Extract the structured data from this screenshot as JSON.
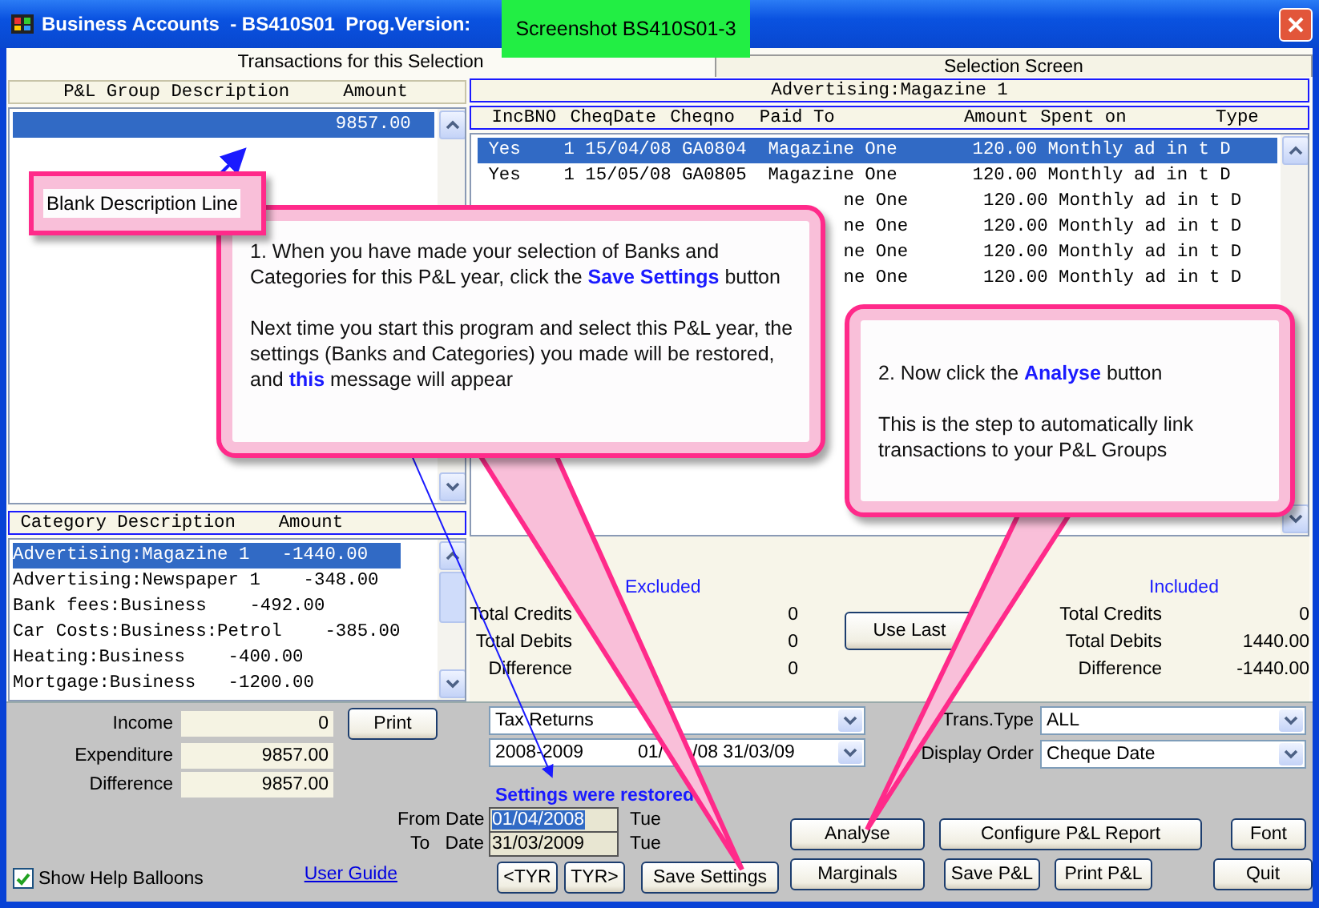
{
  "window": {
    "title": "Business Accounts  - BS410S01  Prog.Version:"
  },
  "screenshot_label": "Screenshot BS410S01-3",
  "tabs": [
    {
      "label": "Transactions for this Selection",
      "selected": true
    },
    {
      "label": "Selection Screen",
      "selected": false
    }
  ],
  "pl_groups": {
    "columns": [
      "P&L Group Description",
      "Amount"
    ],
    "rows": [
      {
        "description": "",
        "amount": "9857.00",
        "selected": true
      }
    ]
  },
  "categories": {
    "columns": [
      "Category Description",
      "Amount"
    ],
    "rows": [
      {
        "text": "Advertising:Magazine 1   -1440.00",
        "selected": true
      },
      {
        "text": "Advertising:Newspaper 1    -348.00",
        "selected": false
      },
      {
        "text": "Bank fees:Business    -492.00",
        "selected": false
      },
      {
        "text": "Car Costs:Business:Petrol    -385.00",
        "selected": false
      },
      {
        "text": "Heating:Business    -400.00",
        "selected": false
      },
      {
        "text": "Mortgage:Business   -1200.00",
        "selected": false
      }
    ]
  },
  "transactions": {
    "title": "Advertising:Magazine 1",
    "columns": [
      "IncBNO",
      "CheqDate",
      "Cheqno",
      "Paid To",
      "Amount",
      "Spent on",
      "Type"
    ],
    "rows": [
      {
        "inc": "Yes",
        "bno": "1",
        "date": "15/04/08",
        "cheqno": "GA0804",
        "paid_to": "Magazine One",
        "amount": "120.00",
        "spent_on": "Monthly ad in t",
        "type": "D",
        "selected": true
      },
      {
        "inc": "Yes",
        "bno": "1",
        "date": "15/05/08",
        "cheqno": "GA0805",
        "paid_to": "Magazine One",
        "amount": "120.00",
        "spent_on": "Monthly ad in t",
        "type": "D",
        "selected": false
      },
      {
        "paid_to": "ne One",
        "amount": "120.00",
        "spent_on": "Monthly ad in t",
        "type": "D",
        "selected": false
      },
      {
        "paid_to": "ne One",
        "amount": "120.00",
        "spent_on": "Monthly ad in t",
        "type": "D",
        "selected": false
      },
      {
        "paid_to": "ne One",
        "amount": "120.00",
        "spent_on": "Monthly ad in t",
        "type": "D",
        "selected": false
      },
      {
        "paid_to": "ne One",
        "amount": "120.00",
        "spent_on": "Monthly ad in t",
        "type": "D",
        "selected": false
      }
    ]
  },
  "summary": [
    {
      "title": "Excluded",
      "rows": [
        {
          "label": "Total Credits",
          "value": "0"
        },
        {
          "label": "Total Debits",
          "value": "0"
        },
        {
          "label": "Difference",
          "value": "0"
        }
      ]
    },
    {
      "title": "Included",
      "rows": [
        {
          "label": "Total Credits",
          "value": "0"
        },
        {
          "label": "Total Debits",
          "value": "1440.00"
        },
        {
          "label": "Difference",
          "value": "-1440.00"
        }
      ]
    }
  ],
  "use_last_button": "Use Last",
  "totals": [
    {
      "label": "Income",
      "value": "0"
    },
    {
      "label": "Expenditure",
      "value": "9857.00"
    },
    {
      "label": "Difference",
      "value": "9857.00"
    }
  ],
  "print_button": "Print",
  "report_type": "Tax Returns",
  "period": {
    "year": "2008-2009",
    "range_start": "01/",
    "range_end": "/08 31/03/09"
  },
  "status": "Settings were restored",
  "dates": [
    {
      "label": "From Date",
      "value": "01/04/2008",
      "day": "Tue",
      "highlighted": true
    },
    {
      "label": "To   Date",
      "value": "31/03/2009",
      "day": "Tue",
      "highlighted": false
    }
  ],
  "year_buttons": [
    "<TYR",
    "TYR>"
  ],
  "save_settings_button": "Save Settings",
  "filters": [
    {
      "label": "Trans.Type",
      "value": "ALL"
    },
    {
      "label": "Display Order",
      "value": "Cheque Date"
    }
  ],
  "actions_row1": [
    "Analyse",
    "Configure P&L Report",
    "Font"
  ],
  "actions_row2": [
    "Marginals",
    "Save P&L",
    "Print P&L",
    "Quit"
  ],
  "user_guide_link": "User Guide",
  "help_balloons": {
    "label": "Show Help Balloons",
    "checked": true
  },
  "callouts": [
    {
      "text": "Blank Description Line"
    },
    {
      "paragraphs": [
        "1. When you have made your selection of Banks and Categories for this P&L year, click the **Save Settings** button",
        "Next time you start this program and select this P&L year, the settings (Banks and Categories) you made will be restored, and **this** message will appear"
      ]
    },
    {
      "paragraphs": [
        "2. Now click the **Analyse** button",
        "This is the step to automatically link transactions to your P&L Groups"
      ]
    }
  ]
}
